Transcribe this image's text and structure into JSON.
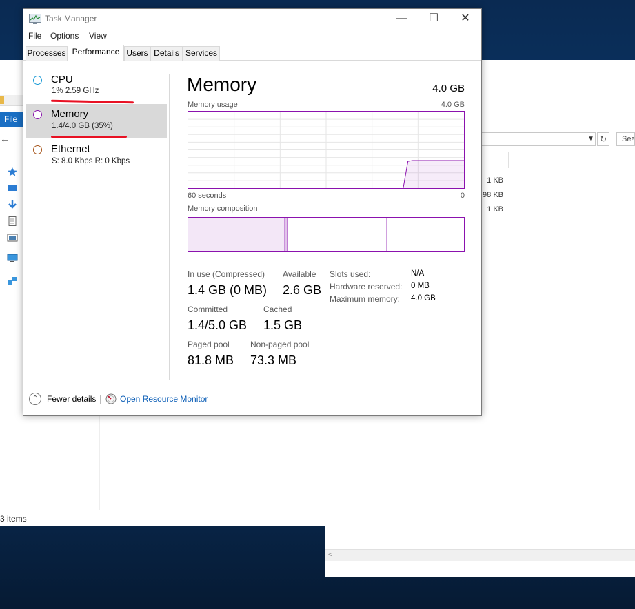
{
  "background": {
    "file_tab": "File",
    "search_placeholder": "Sea",
    "sizes": [
      "1 KB",
      "98 KB",
      "1 KB"
    ],
    "status": "3 items",
    "scroll_arrow": "<"
  },
  "window": {
    "title": "Task Manager",
    "menu": [
      "File",
      "Options",
      "View"
    ],
    "tabs": [
      "Processes",
      "Performance",
      "Users",
      "Details",
      "Services"
    ],
    "active_tab": "Performance"
  },
  "sidebar": {
    "items": [
      {
        "title": "CPU",
        "sub": "1%  2.59 GHz",
        "color": "#1a9ad6"
      },
      {
        "title": "Memory",
        "sub": "1.4/4.0 GB (35%)",
        "color": "#8b12ae"
      },
      {
        "title": "Ethernet",
        "sub": "S: 8.0 Kbps  R: 0 Kbps",
        "color": "#a7561c"
      }
    ],
    "selected": "Memory"
  },
  "memory": {
    "heading": "Memory",
    "total": "4.0 GB",
    "usage_label": "Memory usage",
    "usage_max": "4.0 GB",
    "time_left": "60 seconds",
    "time_right": "0",
    "composition_label": "Memory composition",
    "usage_history_fraction": [
      0,
      0,
      0,
      0,
      0,
      0,
      0,
      0,
      0,
      0,
      0,
      0,
      0,
      0,
      0,
      0,
      0,
      0,
      0,
      0,
      0,
      0,
      0,
      0,
      0,
      0,
      0,
      0,
      0,
      0,
      0,
      0,
      0,
      0,
      0,
      0,
      0,
      0,
      0,
      0,
      0,
      0,
      0,
      0,
      0,
      0,
      0,
      0.35,
      0.36,
      0.36,
      0.36,
      0.36,
      0.36,
      0.36,
      0.36,
      0.36,
      0.36,
      0.36,
      0.36,
      0.36
    ],
    "composition_fractions": {
      "in_use": 0.35,
      "modified": 0.01,
      "standby": 0.36,
      "free": 0.28
    },
    "stats": {
      "in_use_label": "In use (Compressed)",
      "in_use_value": "1.4 GB (0 MB)",
      "available_label": "Available",
      "available_value": "2.6 GB",
      "committed_label": "Committed",
      "committed_value": "1.4/5.0 GB",
      "cached_label": "Cached",
      "cached_value": "1.5 GB",
      "paged_label": "Paged pool",
      "paged_value": "81.8 MB",
      "nonpaged_label": "Non-paged pool",
      "nonpaged_value": "73.3 MB"
    },
    "hardware": {
      "slots_label": "Slots used:",
      "slots_value": "N/A",
      "reserved_label": "Hardware reserved:",
      "reserved_value": "0 MB",
      "max_label": "Maximum memory:",
      "max_value": "4.0 GB"
    }
  },
  "footer": {
    "fewer_details": "Fewer details",
    "resource_monitor": "Open Resource Monitor"
  },
  "colors": {
    "memory_accent": "#8b12ae",
    "annotation_red": "#e81123",
    "link_blue": "#0a5db6"
  }
}
